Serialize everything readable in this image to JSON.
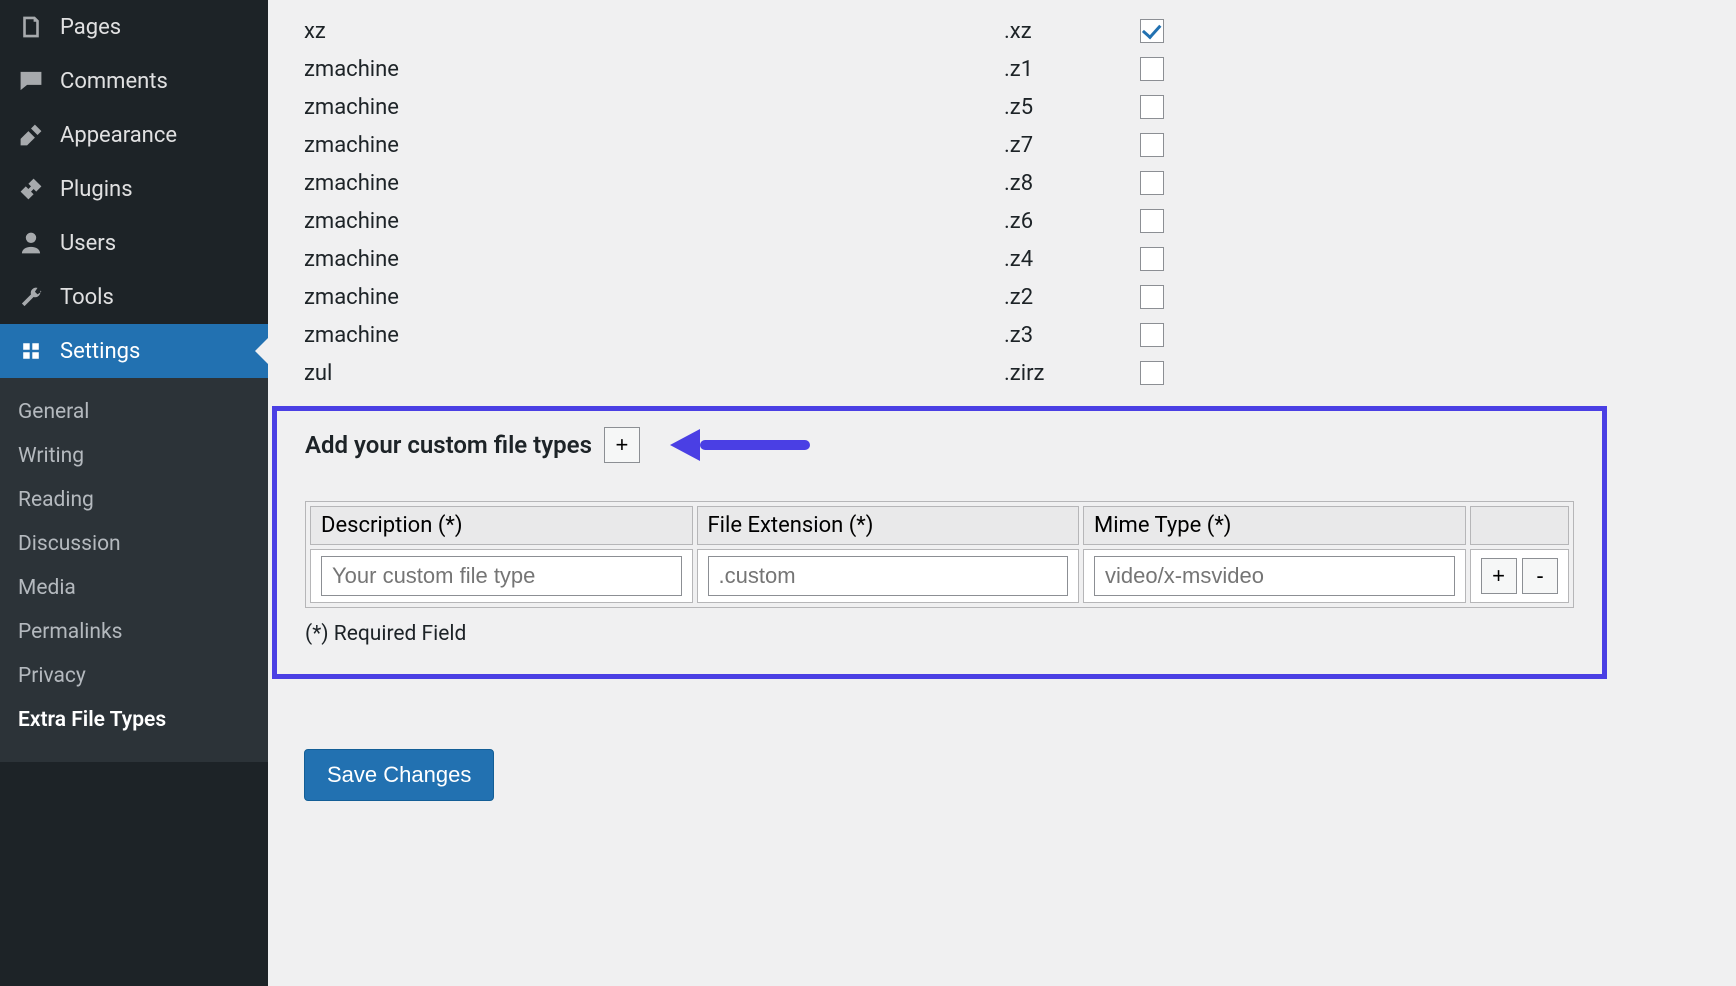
{
  "sidebar": {
    "menu": [
      {
        "label": "Pages",
        "icon": "pages"
      },
      {
        "label": "Comments",
        "icon": "comments"
      },
      {
        "label": "Appearance",
        "icon": "appearance"
      },
      {
        "label": "Plugins",
        "icon": "plugins"
      },
      {
        "label": "Users",
        "icon": "users"
      },
      {
        "label": "Tools",
        "icon": "tools"
      },
      {
        "label": "Settings",
        "icon": "settings",
        "active": true
      }
    ],
    "submenu": [
      {
        "label": "General"
      },
      {
        "label": "Writing"
      },
      {
        "label": "Reading"
      },
      {
        "label": "Discussion"
      },
      {
        "label": "Media"
      },
      {
        "label": "Permalinks"
      },
      {
        "label": "Privacy"
      },
      {
        "label": "Extra File Types",
        "current": true
      }
    ]
  },
  "filetypes": [
    {
      "name": "xz",
      "ext": ".xz",
      "checked": true
    },
    {
      "name": "zmachine",
      "ext": ".z1",
      "checked": false
    },
    {
      "name": "zmachine",
      "ext": ".z5",
      "checked": false
    },
    {
      "name": "zmachine",
      "ext": ".z7",
      "checked": false
    },
    {
      "name": "zmachine",
      "ext": ".z8",
      "checked": false
    },
    {
      "name": "zmachine",
      "ext": ".z6",
      "checked": false
    },
    {
      "name": "zmachine",
      "ext": ".z4",
      "checked": false
    },
    {
      "name": "zmachine",
      "ext": ".z2",
      "checked": false
    },
    {
      "name": "zmachine",
      "ext": ".z3",
      "checked": false
    },
    {
      "name": "zul",
      "ext": ".zirz",
      "checked": false
    }
  ],
  "custom": {
    "heading": "Add your custom file types",
    "add_button": "+",
    "headers": {
      "desc": "Description (*)",
      "ext": "File Extension (*)",
      "mime": "Mime Type (*)"
    },
    "row": {
      "desc_placeholder": "Your custom file type",
      "ext_placeholder": ".custom",
      "mime_placeholder": "video/x-msvideo",
      "add": "+",
      "remove": "-"
    },
    "required_note": "(*) Required Field"
  },
  "save_label": "Save Changes"
}
